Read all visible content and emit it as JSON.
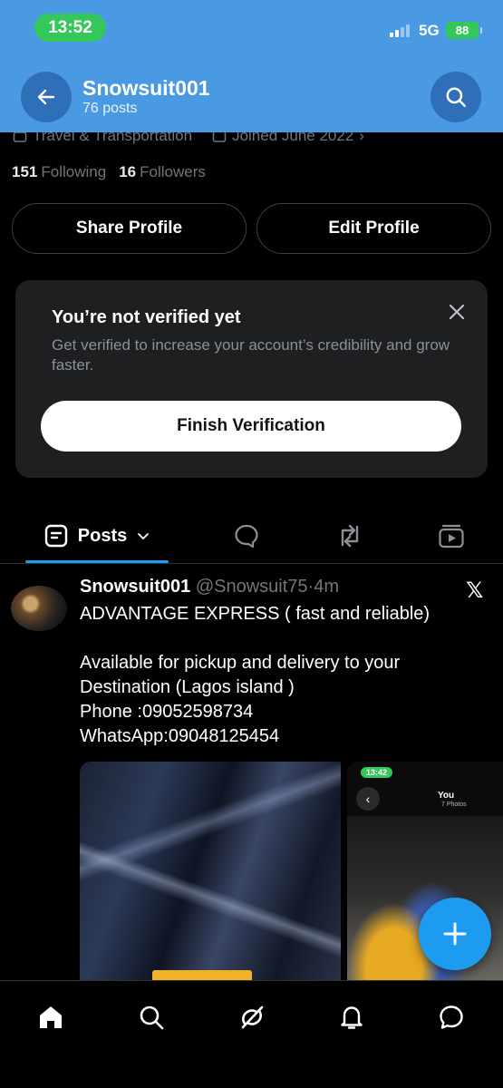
{
  "status_bar": {
    "time": "13:52",
    "network": "5G",
    "battery": "88"
  },
  "header": {
    "name": "Snowsuit001",
    "posts_count": "76 posts"
  },
  "meta": {
    "category": "Travel & Transportation",
    "joined": "Joined June 2022"
  },
  "follow": {
    "following_count": "151",
    "following_label": "Following",
    "followers_count": "16",
    "followers_label": "Followers"
  },
  "profile_buttons": {
    "share": "Share Profile",
    "edit": "Edit Profile"
  },
  "verification": {
    "title": "You’re not verified yet",
    "description": "Get verified to increase your account’s credibility and grow faster.",
    "button": "Finish Verification"
  },
  "tabs": {
    "posts_label": "Posts"
  },
  "post": {
    "author": "Snowsuit001",
    "handle": "@Snowsuit75",
    "separator": "·",
    "age": "4m",
    "body": "ADVANTAGE EXPRESS ( fast and reliable)\n\nAvailable for pickup and delivery to your Destination (Lagos island )\n Phone :09052598734\nWhatsApp:09048125454",
    "image2_time": "13:42",
    "image2_title": "You",
    "image2_subtitle": "7 Photos"
  },
  "colors": {
    "header_bg": "#4a9ae3",
    "accent": "#1d9bf0",
    "background": "#000000"
  }
}
